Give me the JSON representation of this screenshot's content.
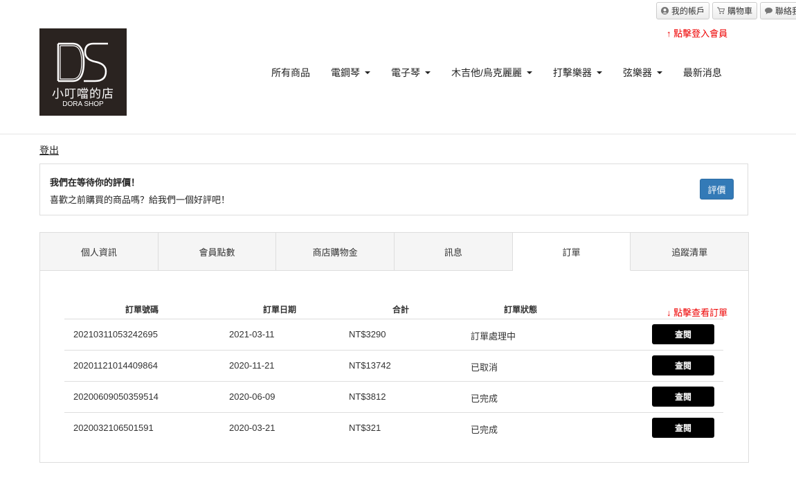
{
  "utility": {
    "account": "我的帳戶",
    "cart": "購物車",
    "contact": "聯絡我"
  },
  "login_hint": "↑ 點擊登入會員",
  "logo": {
    "cn": "小叮噹的店",
    "en": "DORA SHOP"
  },
  "nav": [
    {
      "label": "所有商品",
      "dropdown": false
    },
    {
      "label": "電鋼琴",
      "dropdown": true
    },
    {
      "label": "電子琴",
      "dropdown": true
    },
    {
      "label": "木吉他/烏克麗麗",
      "dropdown": true
    },
    {
      "label": "打擊樂器",
      "dropdown": true
    },
    {
      "label": "弦樂器",
      "dropdown": true
    },
    {
      "label": "最新消息",
      "dropdown": false
    }
  ],
  "logout": "登出",
  "review": {
    "title": "我們在等待你的評價！",
    "text": "喜歡之前購買的商品嗎？給我們一個好評吧！",
    "button": "評價"
  },
  "tabs": [
    {
      "label": "個人資訊",
      "active": false
    },
    {
      "label": "會員點數",
      "active": false
    },
    {
      "label": "商店購物金",
      "active": false
    },
    {
      "label": "訊息",
      "active": false
    },
    {
      "label": "訂單",
      "active": true
    },
    {
      "label": "追蹤清單",
      "active": false
    }
  ],
  "orders": {
    "headers": [
      "訂單號碼",
      "訂單日期",
      "合計",
      "訂單狀態"
    ],
    "hint": "↓ 點擊查看訂單",
    "view_label": "查閱",
    "rows": [
      {
        "number": "20210311053242695",
        "date": "2021-03-11",
        "total": "NT$3290",
        "status": "訂單處理中"
      },
      {
        "number": "20201121014409864",
        "date": "2020-11-21",
        "total": "NT$13742",
        "status": "已取消"
      },
      {
        "number": "20200609050359514",
        "date": "2020-06-09",
        "total": "NT$3812",
        "status": "已完成"
      },
      {
        "number": "2020032106501591",
        "date": "2020-03-21",
        "total": "NT$321",
        "status": "已完成"
      }
    ]
  }
}
